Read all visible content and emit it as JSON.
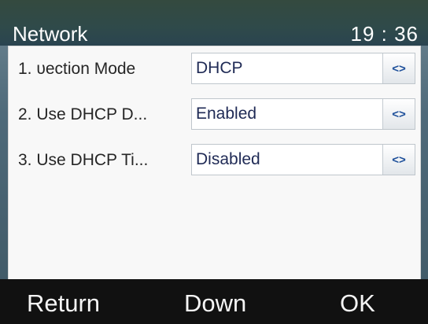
{
  "header": {
    "title": "Network",
    "time": "19 : 36"
  },
  "rows": [
    {
      "label": "1. ᴜection Mode",
      "value": "DHCP",
      "switch_icon": "left-right-arrows-icon"
    },
    {
      "label": "2. Use DHCP D...",
      "value": "Enabled",
      "switch_icon": "left-right-arrows-icon"
    },
    {
      "label": "3. Use DHCP Ti...",
      "value": "Disabled",
      "switch_icon": "left-right-arrows-icon"
    }
  ],
  "softkeys": {
    "left": "Return",
    "middle": "Down",
    "right": "OK"
  },
  "colors": {
    "title_bar": "#2f4a4a",
    "softkey_bar": "#111111",
    "switch_icon": "#1d4f9a",
    "value_text": "#1f2a55"
  }
}
